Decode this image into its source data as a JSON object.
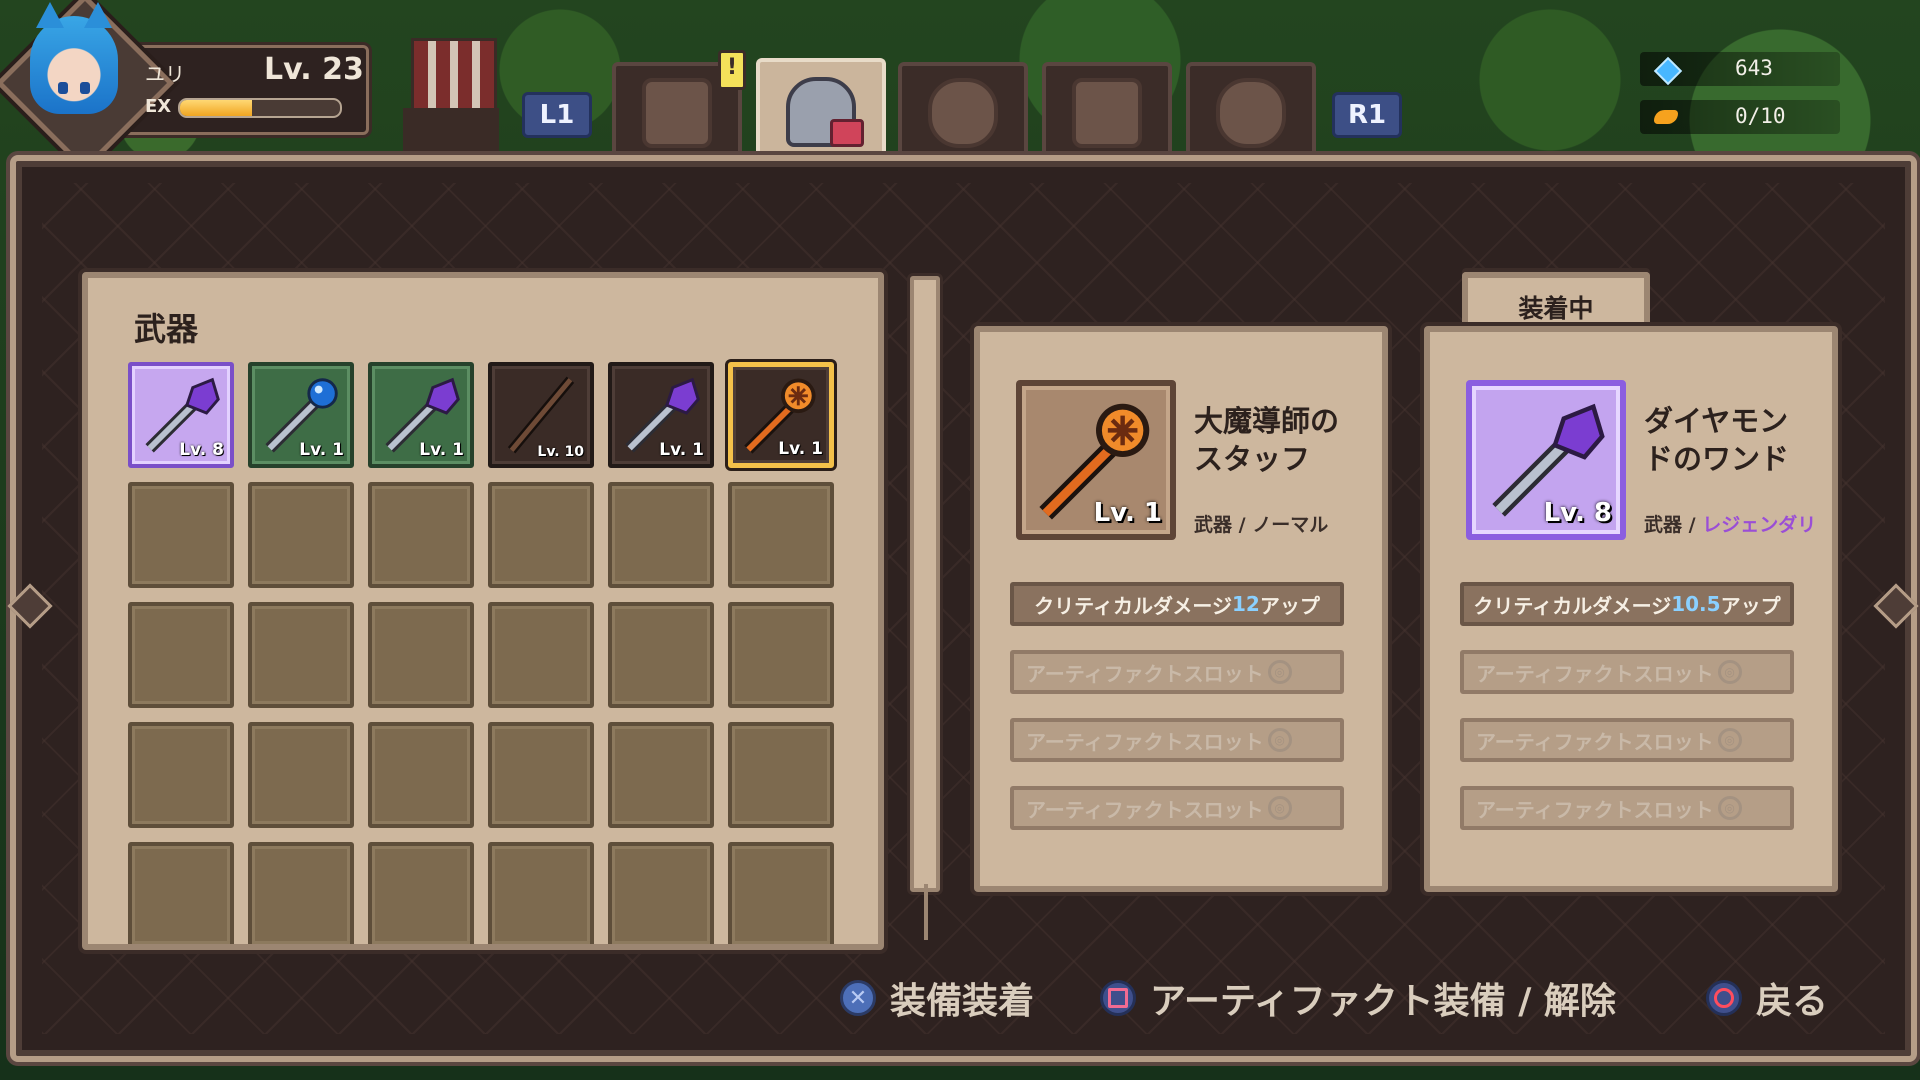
{
  "player": {
    "name": "ユリ",
    "level": "Lv. 23",
    "ex_label": "EX",
    "ex_progress": 0.45
  },
  "tab_hints": {
    "left": "L1",
    "right": "R1"
  },
  "tabs": [
    {
      "icon": "cat-face-icon"
    },
    {
      "icon": "knight-helmet-icon"
    },
    {
      "icon": "wood-log-icon"
    },
    {
      "icon": "scroll-icon"
    },
    {
      "icon": "pot-icon"
    }
  ],
  "active_tab": 1,
  "alert_badge": "!",
  "currency": {
    "gems": "643",
    "fish": "0/10"
  },
  "inventory": {
    "title": "武器",
    "items": [
      {
        "level": "Lv. 8",
        "rarity": "legend",
        "icon": "purple-gem-wand-icon"
      },
      {
        "level": "Lv. 1",
        "rarity": "green",
        "icon": "blue-orb-wand-icon"
      },
      {
        "level": "Lv. 1",
        "rarity": "green",
        "icon": "purple-gem-wand-icon"
      },
      {
        "level": "Lv. 10",
        "rarity": "dark",
        "icon": "wooden-staff-icon"
      },
      {
        "level": "Lv. 1",
        "rarity": "dark",
        "icon": "purple-gem-wand-icon"
      },
      {
        "level": "Lv. 1",
        "rarity": "selected",
        "icon": "orange-staff-icon"
      }
    ]
  },
  "selected_item": {
    "name": "大魔導師のスタッフ",
    "level": "Lv. 1",
    "category": "武器",
    "rarity": "ノーマル",
    "stat": {
      "prefix": "クリティカルダメージ",
      "value": "12",
      "suffix": "アップ"
    },
    "slots": [
      "アーティファクトスロット",
      "アーティファクトスロット",
      "アーティファクトスロット"
    ]
  },
  "equipped_item": {
    "tab_label": "装着中",
    "name": "ダイヤモンドのワンド",
    "level": "Lv. 8",
    "category": "武器",
    "rarity": "レジェンダリ",
    "stat": {
      "prefix": "クリティカルダメージ",
      "value": "10.5",
      "suffix": "アップ"
    },
    "slots": [
      "アーティファクトスロット",
      "アーティファクトスロット",
      "アーティファクトスロット"
    ]
  },
  "footer": {
    "equip": "装備装着",
    "artifact": "アーティファクト装備 / 解除",
    "back": "戻る"
  },
  "colors": {
    "legend": "#9a4ed6",
    "selected_border": "#f4c14a",
    "stat_number": "#8ad0ff"
  }
}
